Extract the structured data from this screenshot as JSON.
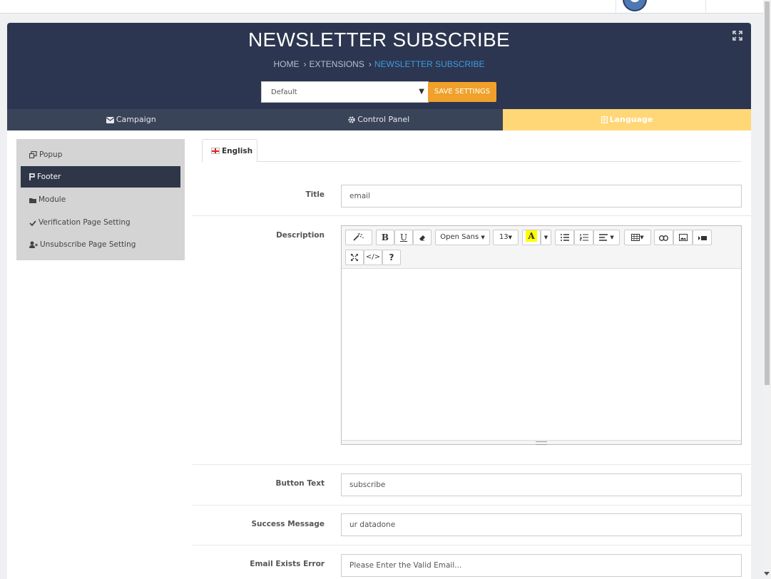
{
  "page": {
    "title": "NEWSLETTER SUBSCRIBE",
    "breadcrumb": [
      "HOME",
      "EXTENSIONS",
      "NEWSLETTER SUBSCRIBE"
    ],
    "breadcrumb_separator": "›"
  },
  "store_select": {
    "value": "Default",
    "caret": "▼"
  },
  "save_button": "SAVE SETTINGS",
  "tabs": [
    {
      "label": "Campaign",
      "icon": "envelope-icon"
    },
    {
      "label": "Control Panel",
      "icon": "gear-icon"
    },
    {
      "label": "Language",
      "icon": "language-icon",
      "active": true
    }
  ],
  "sidebar": {
    "items": [
      {
        "label": "Popup",
        "icon": "popup-icon"
      },
      {
        "label": "Footer",
        "icon": "footer-icon",
        "active": true
      },
      {
        "label": "Module",
        "icon": "folder-icon"
      },
      {
        "label": "Verification Page Setting",
        "icon": "check-icon"
      },
      {
        "label": "Unsubscribe Page Setting",
        "icon": "user-remove-icon"
      }
    ]
  },
  "language_tab": {
    "label": "English",
    "icon": "uk-flag-icon"
  },
  "form": {
    "title_label": "Title",
    "title_value": "email",
    "description_label": "Description",
    "button_text_label": "Button Text",
    "button_text_value": "subscribe",
    "success_label": "Success Message",
    "success_value": "ur datadone",
    "exists_label": "Email Exists Error",
    "exists_value": "Please Enter the Valid Email..."
  },
  "editor_toolbar": {
    "font_name": "Open Sans",
    "font_size": "13",
    "color_letter": "A",
    "code_view": "</>",
    "help": "?"
  },
  "colors": {
    "header_bg": "#2c3650",
    "tab_bar_bg": "#3a4458",
    "active_tab_bg": "#ffd777",
    "save_button_bg": "#f0a12b",
    "breadcrumb_active": "#3f9ae0",
    "sidebar_bg": "#d4d4d4",
    "sidebar_active_bg": "#2e3648"
  }
}
